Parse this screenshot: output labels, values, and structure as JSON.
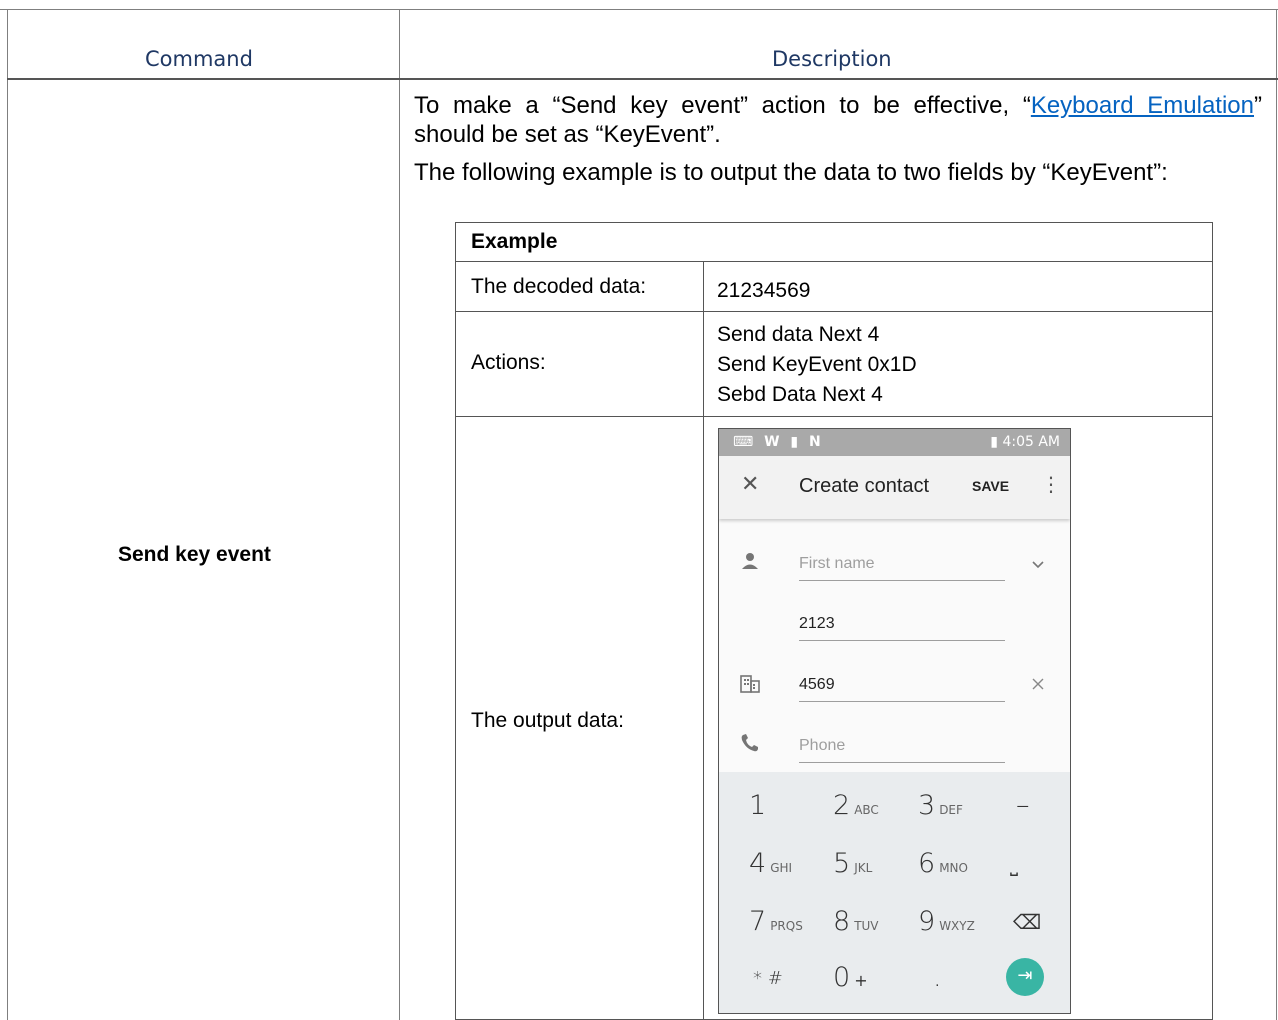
{
  "header": {
    "command": "Command",
    "description": "Description"
  },
  "row": {
    "command": "Send key event",
    "para1_before": "To make a “Send key event” action to be effective, “",
    "para1_link": "Keyboard Emulation",
    "para1_after": "” should be set as “KeyEvent”.",
    "para2": "The following example is to output the data to two fields by “KeyEvent”:"
  },
  "example": {
    "title": "Example",
    "decoded_label": "The decoded data:",
    "decoded_value": "21234569",
    "actions_label": "Actions:",
    "actions": [
      "Send data Next 4",
      "Send KeyEvent 0x1D",
      "Sebd Data Next 4"
    ],
    "output_label": "The output data:"
  },
  "phone": {
    "status_left": "⌨ W ▮ N",
    "status_right": "▮ 4:05 AM",
    "close_icon": "✕",
    "title": "Create contact",
    "save": "SAVE",
    "more_icon": "⋮",
    "fields": {
      "first_name_placeholder": "First name",
      "field2_value": "2123",
      "field3_value": "4569",
      "phone_placeholder": "Phone"
    },
    "icons": {
      "person": "person-icon",
      "company": "building-icon",
      "phone": "phone-icon",
      "chevron": "chevron-down-icon",
      "clear": "clear-icon"
    },
    "keys": [
      {
        "d": "1",
        "s": ""
      },
      {
        "d": "2",
        "s": "ABC"
      },
      {
        "d": "3",
        "s": "DEF"
      },
      {
        "d": "–",
        "s": ""
      },
      {
        "d": "4",
        "s": "GHI"
      },
      {
        "d": "5",
        "s": "JKL"
      },
      {
        "d": "6",
        "s": "MNO"
      },
      {
        "d": "⎵",
        "s": ""
      },
      {
        "d": "7",
        "s": "PRQS"
      },
      {
        "d": "8",
        "s": "TUV"
      },
      {
        "d": "9",
        "s": "WXYZ"
      },
      {
        "d": "⌫",
        "s": ""
      },
      {
        "d": "* #",
        "s": ""
      },
      {
        "d": "0",
        "s": "+"
      },
      {
        "d": ".",
        "s": ""
      }
    ],
    "enter_icon": "⇥"
  }
}
